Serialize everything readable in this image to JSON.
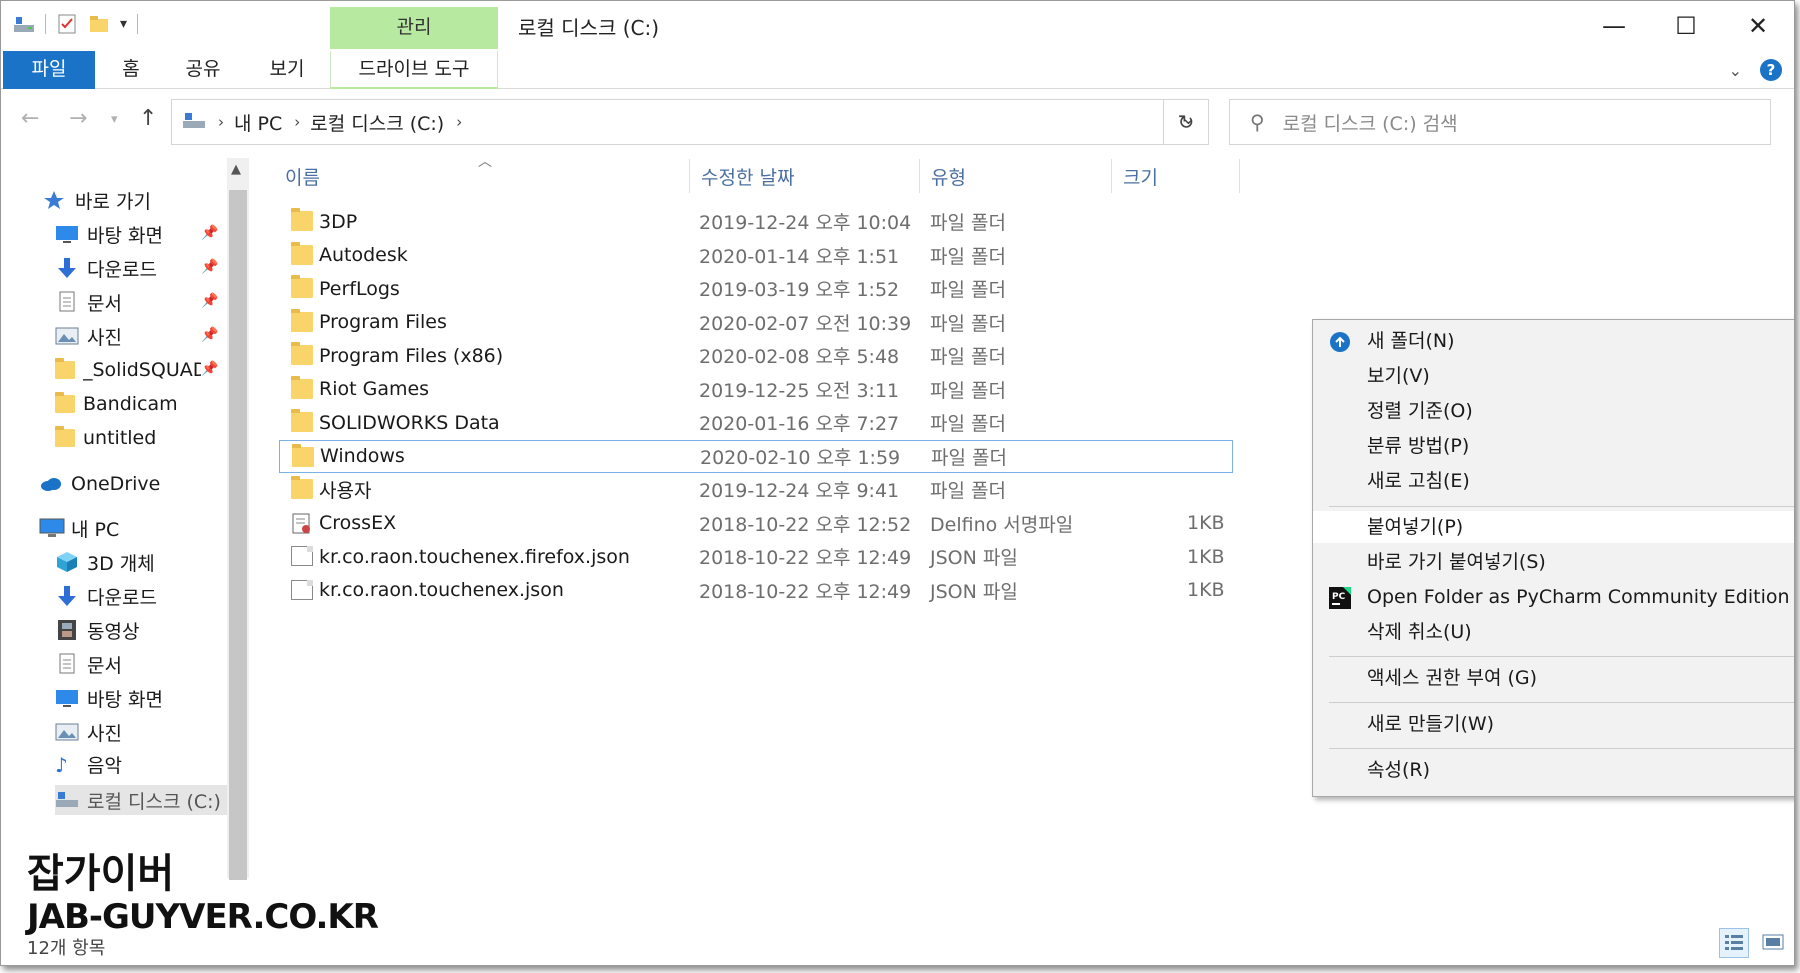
{
  "window": {
    "title": "로컬 디스크 (C:)",
    "context_tab_header": "관리",
    "controls": [
      "—",
      "☐",
      "✕"
    ]
  },
  "ribbon": {
    "tabs": [
      "파일",
      "홈",
      "공유",
      "보기",
      "드라이브 도구"
    ]
  },
  "address": {
    "crumbs": [
      "내 PC",
      "로컬 디스크 (C:)"
    ],
    "search_placeholder": "로컬 디스크 (C:) 검색"
  },
  "nav": {
    "quick_access": "바로 가기",
    "pinned": [
      "바탕 화면",
      "다운로드",
      "문서",
      "사진",
      "_SolidSQUAD_"
    ],
    "recent": [
      "Bandicam",
      "untitled"
    ],
    "onedrive": "OneDrive",
    "this_pc": "내 PC",
    "pc_items": [
      "3D 개체",
      "다운로드",
      "동영상",
      "문서",
      "바탕 화면",
      "사진",
      "음악"
    ],
    "drive": "로컬 디스크 (C:)"
  },
  "columns": {
    "name": "이름",
    "date": "수정한 날짜",
    "type": "유형",
    "size": "크기"
  },
  "files": [
    {
      "name": "3DP",
      "date": "2019-12-24 오후 10:04",
      "type": "파일 폴더",
      "size": "",
      "icon": "folder"
    },
    {
      "name": "Autodesk",
      "date": "2020-01-14 오후 1:51",
      "type": "파일 폴더",
      "size": "",
      "icon": "folder"
    },
    {
      "name": "PerfLogs",
      "date": "2019-03-19 오후 1:52",
      "type": "파일 폴더",
      "size": "",
      "icon": "folder"
    },
    {
      "name": "Program Files",
      "date": "2020-02-07 오전 10:39",
      "type": "파일 폴더",
      "size": "",
      "icon": "folder"
    },
    {
      "name": "Program Files (x86)",
      "date": "2020-02-08 오후 5:48",
      "type": "파일 폴더",
      "size": "",
      "icon": "folder"
    },
    {
      "name": "Riot Games",
      "date": "2019-12-25 오전 3:11",
      "type": "파일 폴더",
      "size": "",
      "icon": "folder"
    },
    {
      "name": "SOLIDWORKS Data",
      "date": "2020-01-16 오후 7:27",
      "type": "파일 폴더",
      "size": "",
      "icon": "folder"
    },
    {
      "name": "Windows",
      "date": "2020-02-10 오후 1:59",
      "type": "파일 폴더",
      "size": "",
      "icon": "folder",
      "selected": true
    },
    {
      "name": "사용자",
      "date": "2019-12-24 오후 9:41",
      "type": "파일 폴더",
      "size": "",
      "icon": "folder"
    },
    {
      "name": "CrossEX",
      "date": "2018-10-22 오후 12:52",
      "type": "Delfino 서명파일",
      "size": "1KB",
      "icon": "cert"
    },
    {
      "name": "kr.co.raon.touchenex.firefox.json",
      "date": "2018-10-22 오후 12:49",
      "type": "JSON 파일",
      "size": "1KB",
      "icon": "doc"
    },
    {
      "name": "kr.co.raon.touchenex.json",
      "date": "2018-10-22 오후 12:49",
      "type": "JSON 파일",
      "size": "1KB",
      "icon": "doc"
    }
  ],
  "context_menu": [
    {
      "label": "새 폴더(N)",
      "icon": "new-folder-icon"
    },
    {
      "label": "보기(V)"
    },
    {
      "label": "정렬 기준(O)"
    },
    {
      "label": "분류 방법(P)"
    },
    {
      "label": "새로 고침(E)"
    },
    {
      "label": "붙여넣기(P)",
      "highlight": true
    },
    {
      "label": "바로 가기 붙여넣기(S)"
    },
    {
      "label": "Open Folder as PyCharm Community Edition Project",
      "icon": "pycharm-icon"
    },
    {
      "label": "삭제 취소(U)"
    },
    {
      "label": "액세스 권한 부여 (G)"
    },
    {
      "label": "새로 만들기(W)"
    },
    {
      "label": "속성(R)"
    }
  ],
  "status": {
    "count": "12개 항목"
  },
  "watermark": {
    "line1": "잡가이버",
    "line2": "JAB-GUYVER.CO.KR"
  },
  "colors": {
    "accent": "#1a73c6",
    "context_tab": "#b7e9a1",
    "selection_border": "#7ab2e8",
    "folder": "#f8d46a"
  }
}
